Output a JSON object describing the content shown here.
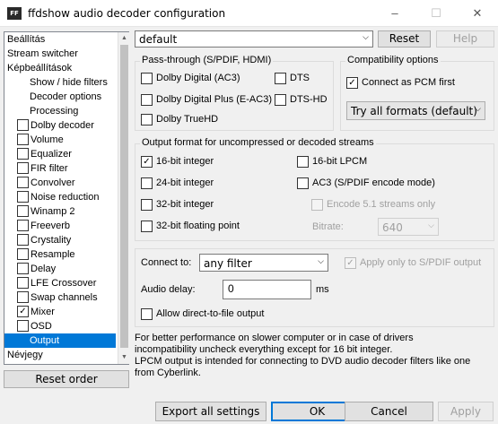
{
  "window": {
    "icon": "ffdshow-icon",
    "title": "ffdshow audio decoder configuration",
    "min": "–",
    "max": "☐",
    "close": "✕"
  },
  "tree": {
    "items": [
      {
        "label": "Beállítás",
        "checkbox": false,
        "indent": 0
      },
      {
        "label": "Stream switcher",
        "checkbox": false,
        "indent": 0
      },
      {
        "label": "Képbeállítások",
        "checkbox": false,
        "indent": 0
      },
      {
        "label": "Show / hide filters",
        "checkbox": false,
        "indent": 1
      },
      {
        "label": "Decoder options",
        "checkbox": false,
        "indent": 1
      },
      {
        "label": "Processing",
        "checkbox": false,
        "indent": 1
      },
      {
        "label": "Dolby decoder",
        "checkbox": true,
        "checked": false,
        "indent": 1
      },
      {
        "label": "Volume",
        "checkbox": true,
        "checked": false,
        "indent": 1
      },
      {
        "label": "Equalizer",
        "checkbox": true,
        "checked": false,
        "indent": 1
      },
      {
        "label": "FIR filter",
        "checkbox": true,
        "checked": false,
        "indent": 1
      },
      {
        "label": "Convolver",
        "checkbox": true,
        "checked": false,
        "indent": 1
      },
      {
        "label": "Noise reduction",
        "checkbox": true,
        "checked": false,
        "indent": 1
      },
      {
        "label": "Winamp 2",
        "checkbox": true,
        "checked": false,
        "indent": 1
      },
      {
        "label": "Freeverb",
        "checkbox": true,
        "checked": false,
        "indent": 1
      },
      {
        "label": "Crystality",
        "checkbox": true,
        "checked": false,
        "indent": 1
      },
      {
        "label": "Resample",
        "checkbox": true,
        "checked": false,
        "indent": 1
      },
      {
        "label": "Delay",
        "checkbox": true,
        "checked": false,
        "indent": 1
      },
      {
        "label": "LFE Crossover",
        "checkbox": true,
        "checked": false,
        "indent": 1
      },
      {
        "label": "Swap channels",
        "checkbox": true,
        "checked": false,
        "indent": 1
      },
      {
        "label": "Mixer",
        "checkbox": true,
        "checked": true,
        "indent": 1
      },
      {
        "label": "OSD",
        "checkbox": true,
        "checked": false,
        "indent": 1
      },
      {
        "label": "Output",
        "checkbox": false,
        "indent": 1,
        "selected": true
      },
      {
        "label": "Névjegy",
        "checkbox": false,
        "indent": 0
      }
    ]
  },
  "reset_order": "Reset order",
  "preset": {
    "value": "default",
    "reset": "Reset",
    "help": "Help"
  },
  "passthrough": {
    "title": "Pass-through (S/PDIF, HDMI)",
    "dd": "Dolby Digital (AC3)",
    "dts": "DTS",
    "ddp": "Dolby Digital Plus (E-AC3)",
    "dtshd": "DTS-HD",
    "truehd": "Dolby TrueHD"
  },
  "compat": {
    "title": "Compatibility options",
    "connect_pcm": "Connect as PCM first",
    "formats": "Try all formats (default)"
  },
  "output": {
    "title": "Output format for uncompressed or decoded streams",
    "i16": "16-bit integer",
    "lpcm": "16-bit LPCM",
    "i24": "24-bit integer",
    "ac3": "AC3 (S/PDIF encode mode)",
    "i32": "32-bit integer",
    "enc51": "Encode 5.1 streams only",
    "f32": "32-bit floating point",
    "bitrate_label": "Bitrate:",
    "bitrate": "640"
  },
  "connection": {
    "connect_label": "Connect to:",
    "connect_value": "any filter",
    "spdif_only": "Apply only to S/PDIF output",
    "delay_label": "Audio delay:",
    "delay_value": "0",
    "ms": "ms",
    "direct": "Allow direct-to-file output"
  },
  "info": {
    "l1": "For better performance on slower computer or in case of drivers",
    "l2": "incompatibility uncheck everything except for 16 bit integer.",
    "l3": "LPCM output is intended for connecting to DVD audio decoder filters like one",
    "l4": "from Cyberlink."
  },
  "footer": {
    "export": "Export all settings",
    "ok": "OK",
    "cancel": "Cancel",
    "apply": "Apply"
  },
  "colors": {
    "accent": "#0078d7",
    "selection": "#0078d7"
  }
}
